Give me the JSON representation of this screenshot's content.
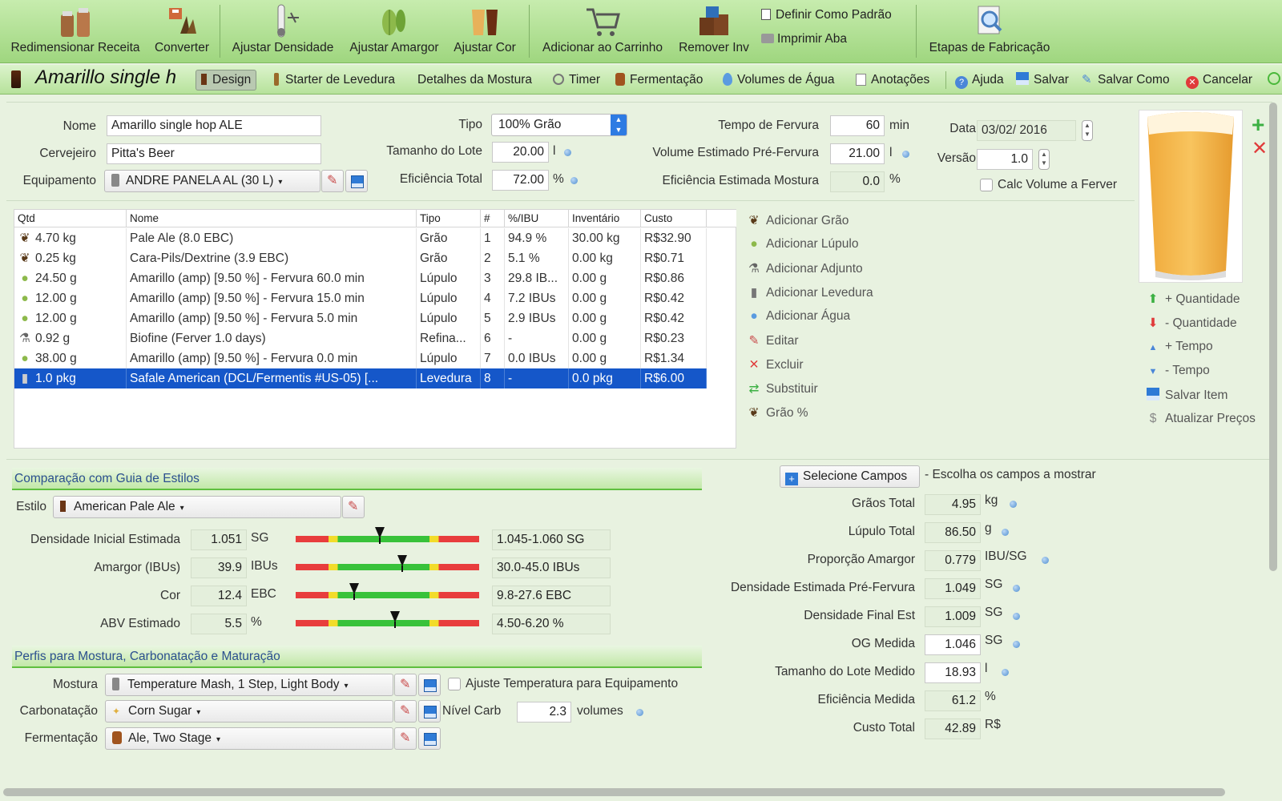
{
  "toolbar": {
    "resize": "Redimensionar Receita",
    "convert": "Converter",
    "adjust_gravity": "Ajustar Densidade",
    "adjust_bitterness": "Ajustar Amargor",
    "adjust_color": "Ajustar Cor",
    "add_to_cart": "Adicionar ao Carrinho",
    "remove_inv": "Remover Inv",
    "set_default": "Definir Como Padrão",
    "print_tab": "Imprimir Aba",
    "brew_steps": "Etapas de Fabricação"
  },
  "tabs": {
    "recipe_title": "Amarillo single h",
    "design": "Design",
    "yeast_starter": "Starter de Levedura",
    "mash_details": "Detalhes da Mostura",
    "timer": "Timer",
    "fermentation": "Fermentação",
    "water_volumes": "Volumes de Água",
    "notes": "Anotações",
    "help": "Ajuda",
    "save": "Salvar",
    "save_as": "Salvar Como",
    "cancel": "Cancelar"
  },
  "recipe": {
    "name_label": "Nome",
    "name": "Amarillo single hop ALE",
    "brewer_label": "Cervejeiro",
    "brewer": "Pitta's Beer",
    "equipment_label": "Equipamento",
    "equipment": "ANDRE PANELA AL (30 L)",
    "type_label": "Tipo",
    "type": "100% Grão",
    "batch_label": "Tamanho do Lote",
    "batch": "20.00",
    "batch_unit": "l",
    "efficiency_label": "Eficiência Total",
    "efficiency": "72.00",
    "efficiency_unit": "%",
    "boil_time_label": "Tempo de Fervura",
    "boil_time": "60",
    "boil_time_unit": "min",
    "pre_boil_label": "Volume Estimado Pré-Fervura",
    "pre_boil": "21.00",
    "pre_boil_unit": "l",
    "mash_eff_label": "Eficiência Estimada Mostura",
    "mash_eff": "0.0",
    "mash_eff_unit": "%",
    "date_label": "Data",
    "date": "03/02/ 2016",
    "version_label": "Versão",
    "version": "1.0",
    "calc_boil_label": "Calc Volume a Ferver"
  },
  "ingredients": {
    "headers": [
      "Qtd",
      "Nome",
      "Tipo",
      "#",
      "%/IBU",
      "Inventário",
      "Custo"
    ],
    "rows": [
      {
        "icon": "grain-icon",
        "qty": "4.70 kg",
        "name": "Pale Ale (8.0 EBC)",
        "type": "Grão",
        "num": "1",
        "pct": "94.9 %",
        "inv": "30.00 kg",
        "cost": "R$32.90"
      },
      {
        "icon": "grain-icon",
        "qty": "0.25 kg",
        "name": "Cara-Pils/Dextrine (3.9 EBC)",
        "type": "Grão",
        "num": "2",
        "pct": "5.1 %",
        "inv": "0.00 kg",
        "cost": "R$0.71"
      },
      {
        "icon": "hop-icon",
        "qty": "24.50 g",
        "name": "Amarillo (amp) [9.50 %] - Fervura 60.0 min",
        "type": "Lúpulo",
        "num": "3",
        "pct": "29.8 IB...",
        "inv": "0.00 g",
        "cost": "R$0.86"
      },
      {
        "icon": "hop-icon",
        "qty": "12.00 g",
        "name": "Amarillo (amp) [9.50 %] - Fervura 15.0 min",
        "type": "Lúpulo",
        "num": "4",
        "pct": "7.2 IBUs",
        "inv": "0.00 g",
        "cost": "R$0.42"
      },
      {
        "icon": "hop-icon",
        "qty": "12.00 g",
        "name": "Amarillo (amp) [9.50 %] - Fervura 5.0 min",
        "type": "Lúpulo",
        "num": "5",
        "pct": "2.9 IBUs",
        "inv": "0.00 g",
        "cost": "R$0.42"
      },
      {
        "icon": "adjunct-icon",
        "qty": "0.92 g",
        "name": "Biofine (Ferver 1.0 days)",
        "type": "Refina...",
        "num": "6",
        "pct": "-",
        "inv": "0.00 g",
        "cost": "R$0.23"
      },
      {
        "icon": "hop-icon",
        "qty": "38.00 g",
        "name": "Amarillo (amp) [9.50 %] - Fervura 0.0 min",
        "type": "Lúpulo",
        "num": "7",
        "pct": "0.0 IBUs",
        "inv": "0.00 g",
        "cost": "R$1.34"
      },
      {
        "icon": "yeast-icon",
        "qty": "1.0 pkg",
        "name": "Safale American  (DCL/Fermentis #US-05) [...",
        "type": "Levedura",
        "num": "8",
        "pct": "-",
        "inv": "0.0 pkg",
        "cost": "R$6.00",
        "selected": true
      }
    ]
  },
  "actions": {
    "add_grain": "Adicionar Grão",
    "add_hop": "Adicionar Lúpulo",
    "add_adjunct": "Adicionar Adjunto",
    "add_yeast": "Adicionar Levedura",
    "add_water": "Adicionar Água",
    "edit": "Editar",
    "delete": "Excluir",
    "substitute": "Substituir",
    "grain_pct": "Grão %"
  },
  "side_actions": {
    "qty_plus": "+ Quantidade",
    "qty_minus": "- Quantidade",
    "time_plus": "+ Tempo",
    "time_minus": "- Tempo",
    "save_item": "Salvar Item",
    "update_prices": "Atualizar Preços"
  },
  "style_guide": {
    "section_title": "Comparação com Guia de Estilos",
    "style_label": "Estilo",
    "style": "American Pale Ale",
    "rows": [
      {
        "label": "Densidade Inicial Estimada",
        "value": "1.051",
        "unit": "SG",
        "range": "1.045-1.060 SG",
        "marker_pct": 0.46
      },
      {
        "label": "Amargor (IBUs)",
        "value": "39.9",
        "unit": "IBUs",
        "range": "30.0-45.0 IBUs",
        "marker_pct": 0.58
      },
      {
        "label": "Cor",
        "value": "12.4",
        "unit": "EBC",
        "range": "9.8-27.6 EBC",
        "marker_pct": 0.32
      },
      {
        "label": "ABV Estimado",
        "value": "5.5",
        "unit": "%",
        "range": "4.50-6.20 %",
        "marker_pct": 0.54
      }
    ]
  },
  "profiles": {
    "section_title": "Perfis para Mostura, Carbonatação e Maturação",
    "mash_label": "Mostura",
    "mash": "Temperature Mash, 1 Step, Light Body",
    "adjust_temp_label": "Ajuste Temperatura para Equipamento",
    "carb_label": "Carbonatação",
    "carb": "Corn Sugar",
    "carb_level_label": "Nível Carb",
    "carb_level": "2.3",
    "carb_level_unit": "volumes",
    "ferm_label": "Fermentação",
    "ferm": "Ale, Two Stage"
  },
  "stats": {
    "select_fields": "Selecione Campos",
    "select_hint": "- Escolha os campos a mostrar",
    "rows": [
      {
        "label": "Grãos Total",
        "value": "4.95",
        "unit": "kg",
        "dot": true,
        "ro": true
      },
      {
        "label": "Lúpulo Total",
        "value": "86.50",
        "unit": "g",
        "dot": true,
        "ro": true
      },
      {
        "label": "Proporção Amargor",
        "value": "0.779",
        "unit": "IBU/SG",
        "dot": true,
        "ro": true
      },
      {
        "label": "Densidade Estimada Pré-Fervura",
        "value": "1.049",
        "unit": "SG",
        "dot": true,
        "ro": true
      },
      {
        "label": "Densidade Final Est",
        "value": "1.009",
        "unit": "SG",
        "dot": true,
        "ro": true
      },
      {
        "label": "OG Medida",
        "value": "1.046",
        "unit": "SG",
        "dot": true,
        "ro": false
      },
      {
        "label": "Tamanho do Lote Medido",
        "value": "18.93",
        "unit": "l",
        "dot": true,
        "ro": false
      },
      {
        "label": "Eficiência Medida",
        "value": "61.2",
        "unit": "%",
        "dot": false,
        "ro": true
      },
      {
        "label": "Custo Total",
        "value": "42.89",
        "unit": "R$",
        "dot": false,
        "ro": true
      }
    ]
  },
  "colors": {
    "accent": "#5fbf3f",
    "selection": "#1557c9",
    "toolbar": "#b3e395"
  }
}
